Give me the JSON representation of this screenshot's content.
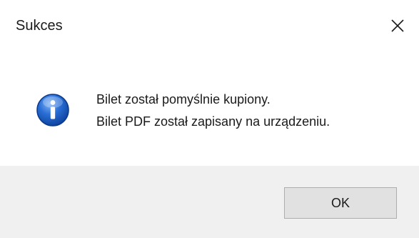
{
  "dialog": {
    "title": "Sukces",
    "icon": "info-icon",
    "message_lines": [
      "Bilet został pomyślnie kupiony.",
      "Bilet PDF został zapisany na urządzeniu."
    ],
    "ok_label": "OK"
  },
  "colors": {
    "accent_edge": "#f3c200",
    "footer_bg": "#f0f0f0",
    "icon_blue": "#1f5fc4"
  }
}
